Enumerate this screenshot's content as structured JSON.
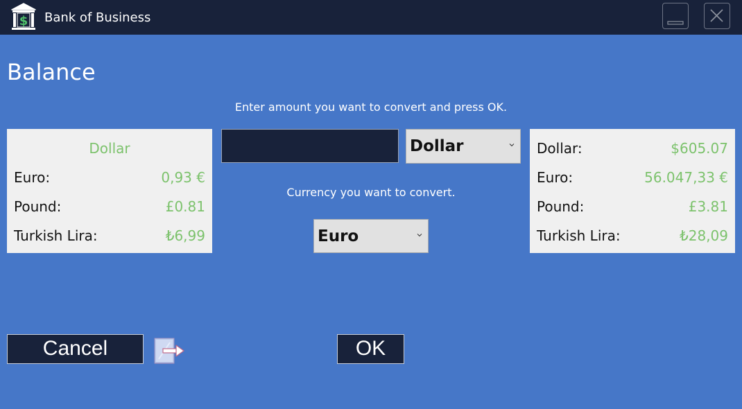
{
  "window": {
    "title": "Bank of Business",
    "icon": "bank-dollar-icon"
  },
  "page": {
    "title": "Balance",
    "amount_hint": "Enter amount you want to convert and press OK.",
    "target_hint": "Currency you want to convert."
  },
  "rates_panel": {
    "base_currency": "Dollar",
    "rows": [
      {
        "label": "Euro:",
        "value": "0,93 €"
      },
      {
        "label": "Pound:",
        "value": "£0.81"
      },
      {
        "label": "Turkish Lira:",
        "value": "₺6,99"
      }
    ]
  },
  "balance_panel": {
    "rows": [
      {
        "label": "Dollar:",
        "value": "$605.07"
      },
      {
        "label": "Euro:",
        "value": "56.047,33 €"
      },
      {
        "label": "Pound:",
        "value": "£3.81"
      },
      {
        "label": "Turkish Lira:",
        "value": "₺28,09"
      }
    ]
  },
  "form": {
    "amount_value": "",
    "from_currency": "Dollar",
    "to_currency": "Euro"
  },
  "buttons": {
    "cancel": "Cancel",
    "ok": "OK"
  },
  "colors": {
    "background": "#4677c8",
    "titlebar": "#18223a",
    "value_green": "#7cc26c",
    "panel": "#f0f0f0"
  }
}
